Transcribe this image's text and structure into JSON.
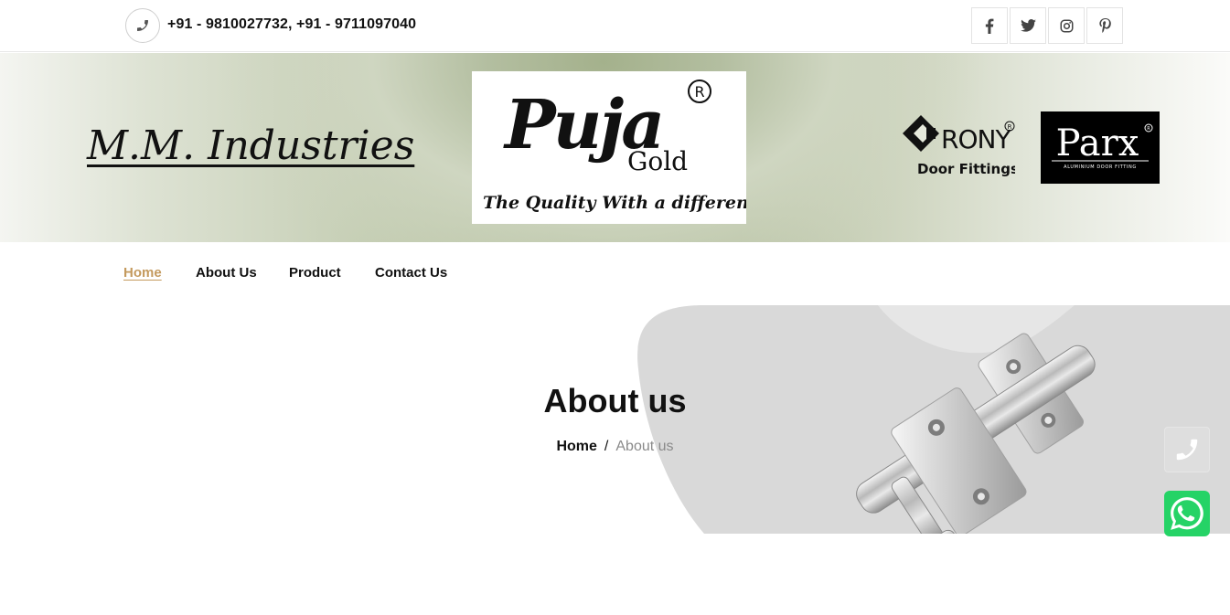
{
  "topbar": {
    "phone_icon": "phone-icon",
    "phones": "+91 - 9810027732,  +91 - 9711097040",
    "social": [
      {
        "name": "facebook-icon",
        "glyph": "f"
      },
      {
        "name": "twitter-icon",
        "glyph": "t"
      },
      {
        "name": "instagram-icon",
        "glyph": "ig"
      },
      {
        "name": "pinterest-icon",
        "glyph": "p"
      }
    ]
  },
  "banner": {
    "brand": "M.M. Industries",
    "puja": {
      "name": "Puja",
      "sub": "Gold",
      "tagline": "The Quality With a difference",
      "reg": "R"
    },
    "crony": {
      "name": "RONY",
      "sub": "Door Fittings",
      "reg": "R"
    },
    "parx": {
      "name": "Parx",
      "sub": "ALUMINIUM DOOR FITTING",
      "reg": "R"
    }
  },
  "nav": {
    "items": [
      "Home",
      "About Us",
      "Product",
      "Contact Us"
    ],
    "active": "Home"
  },
  "hero": {
    "title": "About us",
    "breadcrumb": {
      "home": "Home",
      "separator": "/",
      "current": "About us"
    }
  },
  "floating": {
    "call_icon": "phone-icon",
    "whatsapp_icon": "whatsapp-icon"
  },
  "colors": {
    "accent": "#c49a5e",
    "whatsapp": "#25d366"
  }
}
